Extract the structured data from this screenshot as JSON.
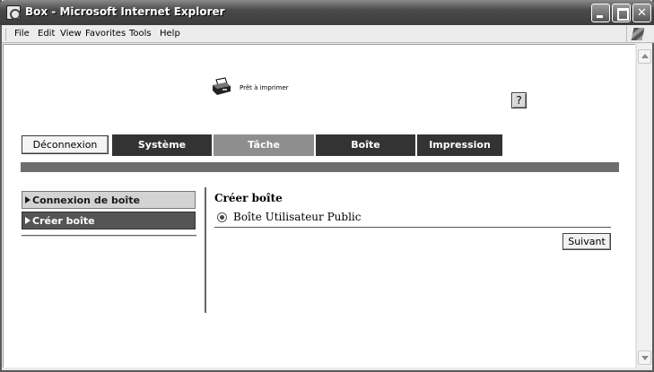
{
  "window": {
    "title": "Box - Microsoft Internet Explorer",
    "controls": {
      "minimize": "minimize-icon",
      "maximize": "maximize-icon",
      "close": "✕"
    }
  },
  "menubar": {
    "items": [
      "File",
      "Edit",
      "View",
      "Favorites",
      "Tools",
      "Help"
    ]
  },
  "header": {
    "status_text": "Prêt à imprimer",
    "help_label": "?"
  },
  "nav": {
    "logout_label": "Déconnexion",
    "tabs": [
      "Système",
      "Tâche",
      "Boîte",
      "Impression"
    ],
    "active_tab": "Boîte"
  },
  "sidebar": {
    "items": [
      {
        "label": "Connexion de boîte"
      },
      {
        "label": "Créer boîte"
      }
    ],
    "selected": "Créer boîte"
  },
  "main": {
    "title": "Créer boîte",
    "option_label": "Boîte Utilisateur Public",
    "option_selected": true,
    "next_label": "Suivant"
  },
  "colors": {
    "tab_dark": "#333333",
    "tab_active": "#8e8e8e",
    "divider_bar": "#6e6e6e"
  }
}
